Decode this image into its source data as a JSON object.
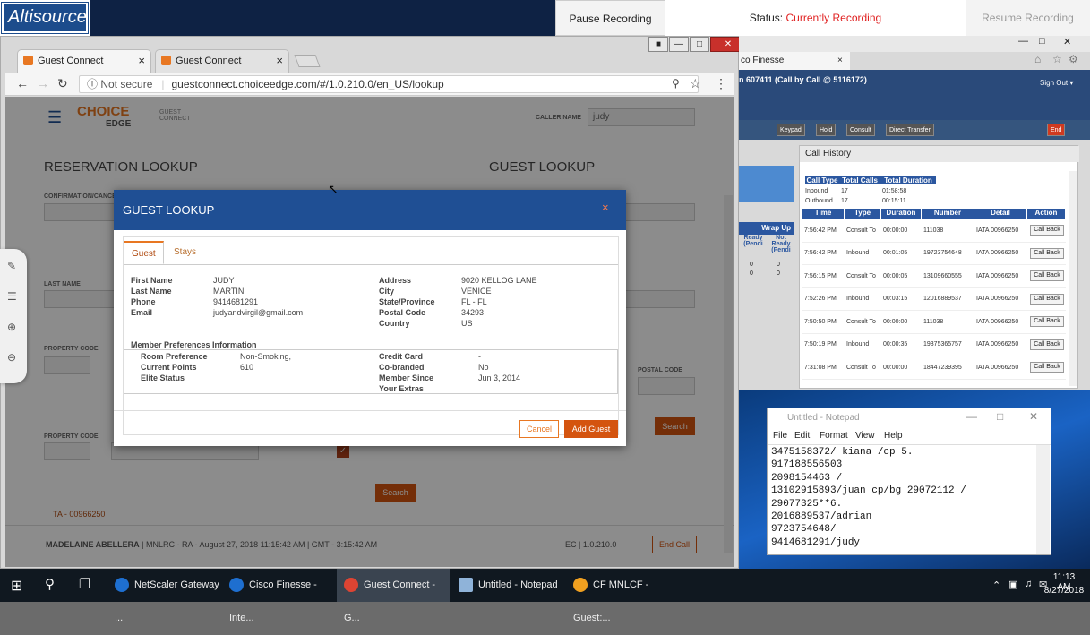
{
  "recorder": {
    "logo": "Altisource",
    "pause_label": "Pause Recording",
    "status_label": "Status:",
    "status_value": "Currently Recording",
    "resume_label": "Resume Recording"
  },
  "browser": {
    "tabs": [
      {
        "label": "Guest Connect",
        "close": "×"
      },
      {
        "label": "Guest Connect",
        "close": "×"
      }
    ],
    "not_secure": "Not secure",
    "url": "guestconnect.choiceedge.com/#/1.0.210.0/en_US/lookup"
  },
  "page": {
    "brand": "CHOICE",
    "brand_sub": "EDGE",
    "brand_side": "GUEST CONNECT",
    "caller_name_label": "CALLER NAME",
    "caller_name_value": "judy",
    "reservation_lookup": "RESERVATION LOOKUP",
    "guest_lookup": "GUEST LOOKUP",
    "confirmation_label": "CONFIRMATION/CANCELLATION",
    "last_name_label": "LAST NAME",
    "property_code_label": "PROPERTY CODE",
    "property_code_label2": "PROPERTY CODE",
    "postal_code_label": "POSTAL CODE",
    "search_label": "Search",
    "search_label2": "Search",
    "ta_label": "TA - 00966250",
    "footer_agent": "MADELAINE ABELLERA",
    "footer_detail": "MNLRC - RA - August 27, 2018 11:15:42 AM | GMT - 3:15:42 AM",
    "footer_version": "EC | 1.0.210.0",
    "end_call": "End Call"
  },
  "modal": {
    "title": "GUEST LOOKUP",
    "close": "×",
    "tabs": [
      "Guest",
      "Stays"
    ],
    "left_fields": [
      {
        "label": "First Name",
        "value": "JUDY"
      },
      {
        "label": "Last Name",
        "value": "MARTIN"
      },
      {
        "label": "Phone",
        "value": "9414681291"
      },
      {
        "label": "Email",
        "value": "judyandvirgil@gmail.com"
      }
    ],
    "right_fields": [
      {
        "label": "Address",
        "value": "9020 KELLOG LANE"
      },
      {
        "label": "City",
        "value": "VENICE"
      },
      {
        "label": "State/Province",
        "value": "FL - FL"
      },
      {
        "label": "Postal Code",
        "value": "34293"
      },
      {
        "label": "Country",
        "value": "US"
      }
    ],
    "pref_header": "Member Preferences Information",
    "pref_left": [
      {
        "label": "Room Preference",
        "value": "Non-Smoking,"
      },
      {
        "label": "Current Points",
        "value": "610"
      },
      {
        "label": "Elite Status",
        "value": ""
      }
    ],
    "pref_right": [
      {
        "label": "Credit Card",
        "value": "-"
      },
      {
        "label": "Co-branded",
        "value": "No"
      },
      {
        "label": "Member Since",
        "value": "Jun 3, 2014"
      },
      {
        "label": "Your Extras",
        "value": ""
      }
    ],
    "cancel": "Cancel",
    "add_guest": "Add Guest"
  },
  "finesse": {
    "tab_label": "co Finesse",
    "call_info": "n 607411 (Call by Call @ 5116172)",
    "sign_out": "Sign Out",
    "buttons": [
      "Keypad",
      "Hold",
      "Consult",
      "Direct Transfer"
    ],
    "end": "End",
    "wrap_up": "Wrap Up",
    "ready_label": "Ready (Pendi",
    "not_ready_label": "Not Ready (Pendi",
    "ready_counts": [
      "0",
      "0"
    ],
    "not_ready_counts": [
      "0",
      "0"
    ],
    "call_history_title": "Call History",
    "summary_headers": [
      "Call Type",
      "Total Calls",
      "Total Duration"
    ],
    "summary_rows": [
      [
        "Inbound",
        "17",
        "01:58:58"
      ],
      [
        "Outbound",
        "17",
        "00:15:11"
      ]
    ],
    "table_headers": [
      "Time",
      "Type",
      "Duration",
      "Number",
      "Detail",
      "Action"
    ],
    "rows": [
      [
        "7:56:42 PM",
        "Consult To",
        "00:00:00",
        "111038",
        "IATA 00966250",
        "Call Back"
      ],
      [
        "7:56:42 PM",
        "Inbound",
        "00:01:05",
        "19723754648",
        "IATA 00966250",
        "Call Back"
      ],
      [
        "7:56:15 PM",
        "Consult To",
        "00:00:05",
        "13109660555",
        "IATA 00966250",
        "Call Back"
      ],
      [
        "7:52:26 PM",
        "Inbound",
        "00:03:15",
        "12016889537",
        "IATA 00966250",
        "Call Back"
      ],
      [
        "7:50:50 PM",
        "Consult To",
        "00:00:00",
        "111038",
        "IATA 00966250",
        "Call Back"
      ],
      [
        "7:50:19 PM",
        "Inbound",
        "00:00:35",
        "19375365757",
        "IATA 00966250",
        "Call Back"
      ],
      [
        "7:31:08 PM",
        "Consult To",
        "00:00:00",
        "18447239395",
        "IATA 00966250",
        "Call Back"
      ]
    ]
  },
  "notepad": {
    "title": "Untitled - Notepad",
    "menu": [
      "File",
      "Edit",
      "Format",
      "View",
      "Help"
    ],
    "text": "3475158372/ kiana /cp 5.\n917188556503\n2098154463 /\n13102915893/juan cp/bg 29072112 /\n29077325**6.\n2016889537/adrian\n9723754648/\n9414681291/judy"
  },
  "taskbar": {
    "items": [
      {
        "label": "NetScaler Gateway ...",
        "color": "#1e6fd0"
      },
      {
        "label": "Cisco Finesse - Inte...",
        "color": "#1e6fd0"
      },
      {
        "label": "Guest Connect - G...",
        "color": "#dd4433"
      },
      {
        "label": "Untitled - Notepad",
        "color": "#8fb3d9"
      },
      {
        "label": "CF MNLCF - Guest:...",
        "color": "#f0a020"
      }
    ],
    "time": "11:13 AM",
    "date": "8/27/2018"
  }
}
